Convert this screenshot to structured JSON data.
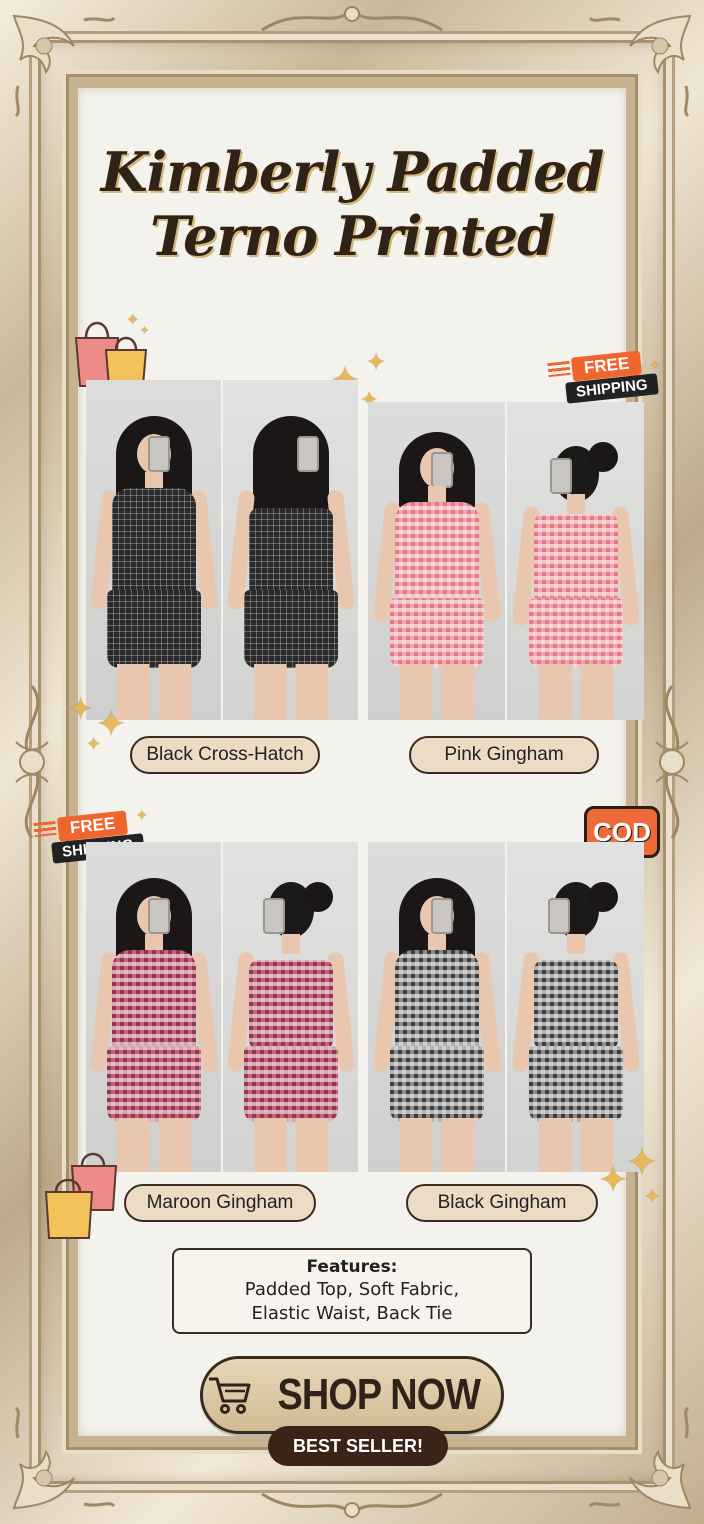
{
  "title": {
    "line1": "Kimberly Padded",
    "line2": "Terno Printed"
  },
  "variants": [
    {
      "label": "Black Cross-Hatch",
      "pattern": "crosshatch"
    },
    {
      "label": "Pink Gingham",
      "pattern": "pink"
    },
    {
      "label": "Maroon Gingham",
      "pattern": "maroon"
    },
    {
      "label": "Black Gingham",
      "pattern": "black-gingham"
    }
  ],
  "badges": {
    "free": "FREE",
    "shipping": "SHIPPING",
    "cod": "COD"
  },
  "features": {
    "heading": "Features:",
    "line1": "Padded Top, Soft Fabric,",
    "line2": "Elastic Waist, Back Tie"
  },
  "cta": {
    "shop_now": "SHOP NOW",
    "best_seller": "BEST SELLER!"
  },
  "icons": {
    "cart": "shopping-cart-icon",
    "sparkle": "sparkle-icon",
    "bag": "shopping-bag-icon"
  },
  "colors": {
    "accent_orange": "#f0642e",
    "frame_gold": "#c9b897",
    "dark_brown": "#3a2418",
    "pill_bg": "#ecdcc5"
  }
}
